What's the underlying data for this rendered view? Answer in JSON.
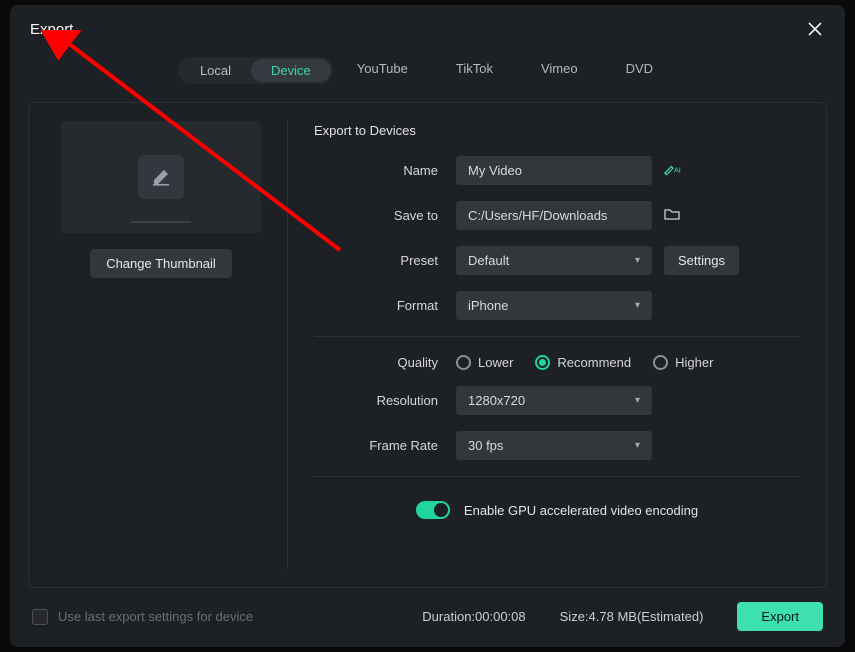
{
  "title": "Export",
  "tabs": {
    "local": "Local",
    "device": "Device",
    "youtube": "YouTube",
    "tiktok": "TikTok",
    "vimeo": "Vimeo",
    "dvd": "DVD"
  },
  "thumbnail": {
    "change": "Change Thumbnail"
  },
  "form": {
    "section": "Export to Devices",
    "name_label": "Name",
    "name_value": "My Video",
    "saveto_label": "Save to",
    "saveto_value": "C:/Users/HF/Downloads",
    "preset_label": "Preset",
    "preset_value": "Default",
    "settings_btn": "Settings",
    "format_label": "Format",
    "format_value": "iPhone",
    "quality_label": "Quality",
    "quality_options": {
      "lower": "Lower",
      "recommend": "Recommend",
      "higher": "Higher"
    },
    "resolution_label": "Resolution",
    "resolution_value": "1280x720",
    "framerate_label": "Frame Rate",
    "framerate_value": "30 fps",
    "gpu_label": "Enable GPU accelerated video encoding"
  },
  "footer": {
    "uselast": "Use last export settings for device",
    "duration": "Duration:00:00:08",
    "size": "Size:4.78 MB(Estimated)",
    "export": "Export"
  }
}
